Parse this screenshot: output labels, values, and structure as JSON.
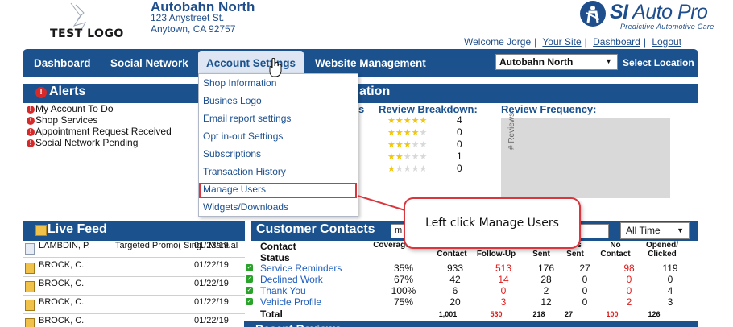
{
  "header": {
    "logo_text": "TEST LOGO",
    "shop_name": "Autobahn North",
    "address_line1": "123 Anystreet St.",
    "address_line2": "Anytown, CA 92757",
    "brand_si": "SI",
    "brand_name": " Auto Pro",
    "brand_tagline": "Predictive Automotive Care",
    "welcome": "Welcome Jorge",
    "links": {
      "your_site": "Your Site",
      "dashboard": "Dashboard",
      "logout": "Logout"
    }
  },
  "nav": {
    "items": [
      "Dashboard",
      "Social Network",
      "Account Settings",
      "Website Management"
    ],
    "location_value": "Autobahn North",
    "select_location": "Select Location"
  },
  "dropdown": {
    "items": [
      "Shop Information",
      "Busines Logo",
      "Email report settings",
      "Opt in-out Settings",
      "Subscriptions",
      "Transaction History",
      "Manage Users",
      "Widgets/Downloads"
    ]
  },
  "alerts": {
    "title": "Alerts",
    "items": [
      "My Account To Do",
      "Shop Services",
      "Appointment Request Received",
      "Social Network Pending"
    ]
  },
  "info": {
    "title_fragment": "ation",
    "s_fragment": "s",
    "review_breakdown": "Review Breakdown:",
    "review_frequency": "Review Frequency:",
    "freq_axis": "# Reviews",
    "breakdown": [
      {
        "stars": 5,
        "count": "4"
      },
      {
        "stars": 4,
        "count": "0"
      },
      {
        "stars": 3,
        "count": "0"
      },
      {
        "stars": 2,
        "count": "1"
      },
      {
        "stars": 1,
        "count": "0"
      }
    ]
  },
  "live_feed": {
    "title": "Live Feed",
    "rows": [
      {
        "name": "LAMBDIN, P.",
        "desc": "Targeted Promo( Sing...Manual",
        "date": "01/23/19"
      },
      {
        "name": "BROCK, C.",
        "desc": "",
        "date": "01/22/19"
      },
      {
        "name": "BROCK, C.",
        "desc": "",
        "date": "01/22/19"
      },
      {
        "name": "BROCK, C.",
        "desc": "",
        "date": "01/22/19"
      },
      {
        "name": "BROCK, C.",
        "desc": "",
        "date": "01/22/19"
      }
    ]
  },
  "customer_contacts": {
    "title": "Customer Contacts",
    "search_value": "m",
    "range": "All Time",
    "col_status": "Contact\nStatus",
    "col_coverage": "Coverage",
    "col_contact": "Contact",
    "col_followup": "Follow-Up",
    "col_sent": "Sent",
    "col_cards": "rds\nSent",
    "col_nocontact": "No\nContact",
    "col_opened": "Opened/\nClicked",
    "rows": [
      {
        "name": "Service Reminders",
        "coverage": "35%",
        "contact": "933",
        "followup": "513",
        "sent": "176",
        "cards": "27",
        "nocontact": "98",
        "opened": "119"
      },
      {
        "name": "Declined Work",
        "coverage": "67%",
        "contact": "42",
        "followup": "14",
        "sent": "28",
        "cards": "0",
        "nocontact": "0",
        "opened": "0"
      },
      {
        "name": "Thank You",
        "coverage": "100%",
        "contact": "6",
        "followup": "0",
        "sent": "2",
        "cards": "0",
        "nocontact": "0",
        "opened": "4"
      },
      {
        "name": "Vehicle Profile",
        "coverage": "75%",
        "contact": "20",
        "followup": "3",
        "sent": "12",
        "cards": "0",
        "nocontact": "2",
        "opened": "3"
      }
    ],
    "total": {
      "label": "Total",
      "contact": "1,001",
      "followup": "530",
      "sent": "218",
      "cards": "27",
      "nocontact": "100",
      "opened": "126"
    },
    "recent_reviews": "Recent Reviews"
  },
  "callout": {
    "text": "Left click Manage Users"
  },
  "colors": {
    "nav_blue": "#1b528e",
    "highlight_red": "#d9363e",
    "link_blue": "#1f5fbf"
  }
}
